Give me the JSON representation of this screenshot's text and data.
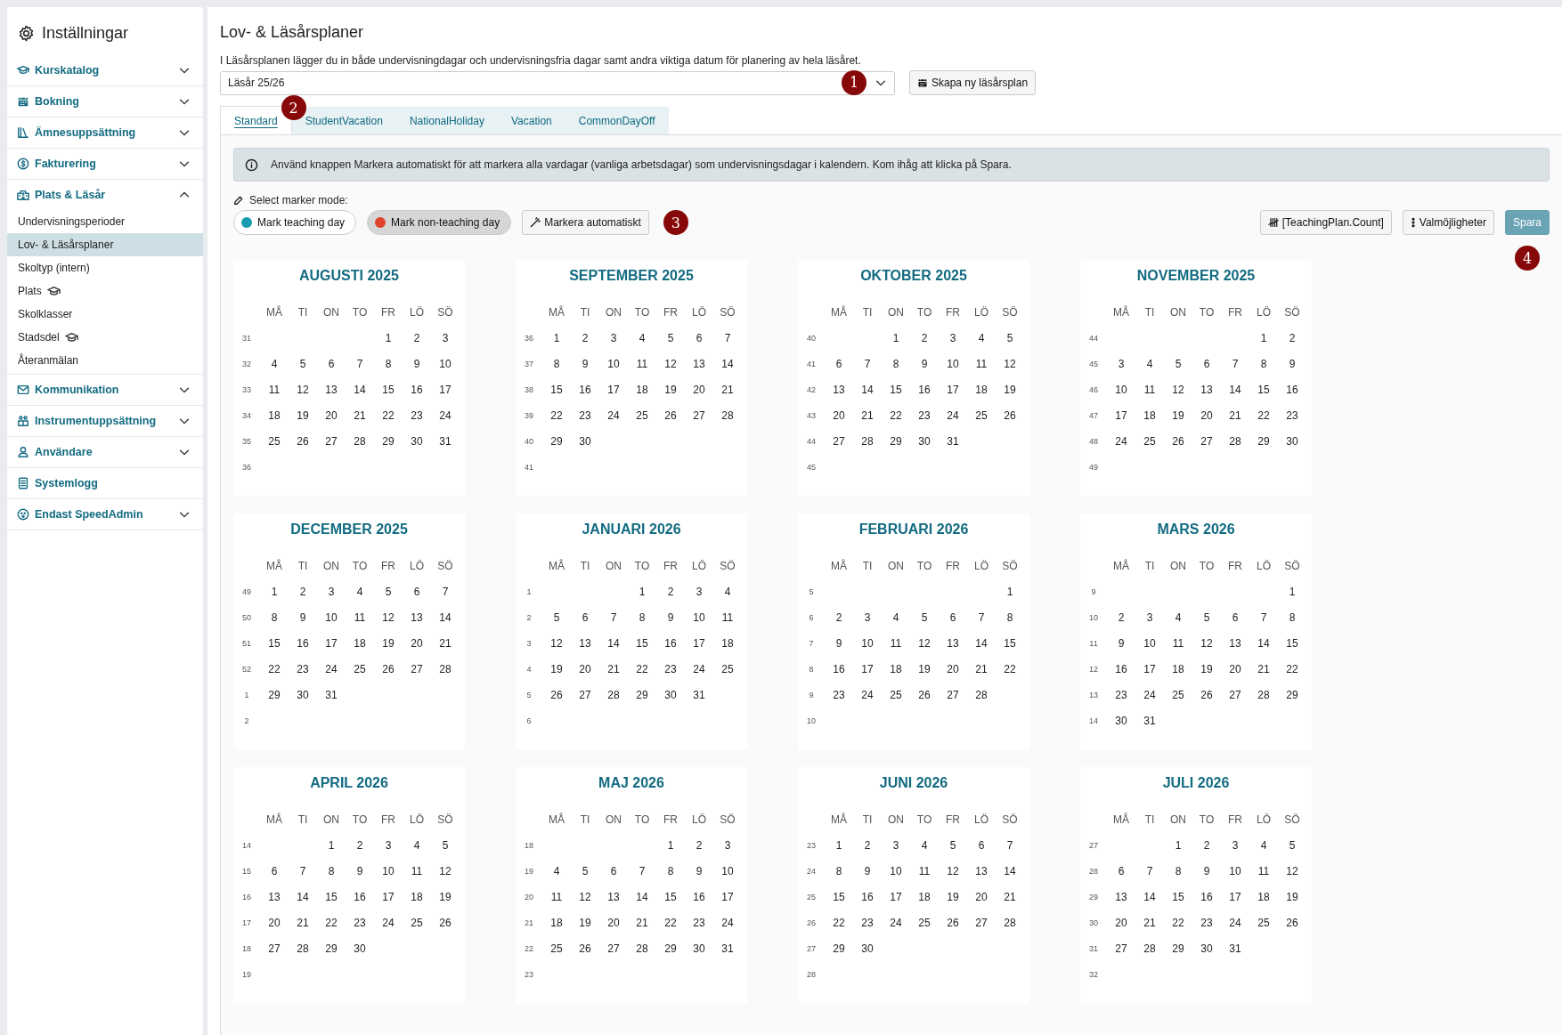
{
  "sidebar": {
    "title": "Inställningar",
    "sections": [
      {
        "label": "Kurskatalog",
        "expanded": false
      },
      {
        "label": "Bokning",
        "expanded": false
      },
      {
        "label": "Ämnesuppsättning",
        "expanded": false
      },
      {
        "label": "Fakturering",
        "expanded": false
      },
      {
        "label": "Plats & Läsår",
        "expanded": true,
        "items": [
          {
            "label": "Undervisningsperioder",
            "selected": false,
            "with_icon": false
          },
          {
            "label": "Lov- & Läsårsplaner",
            "selected": true,
            "with_icon": false
          },
          {
            "label": "Skoltyp (intern)",
            "selected": false,
            "with_icon": false
          },
          {
            "label": "Plats",
            "selected": false,
            "with_icon": true
          },
          {
            "label": "Skolklasser",
            "selected": false,
            "with_icon": false
          },
          {
            "label": "Stadsdel",
            "selected": false,
            "with_icon": true
          },
          {
            "label": "Återanmälan",
            "selected": false,
            "with_icon": false
          }
        ]
      },
      {
        "label": "Kommunikation",
        "expanded": false
      },
      {
        "label": "Instrumentuppsättning",
        "expanded": false
      },
      {
        "label": "Användare",
        "expanded": false
      },
      {
        "label": "Systemlogg"
      },
      {
        "label": "Endast SpeedAdmin",
        "expanded": false
      }
    ]
  },
  "page": {
    "title": "Lov- & Läsårsplaner",
    "description": "I Läsårsplanen lägger du in både undervisningdagar och undervisningsfria dagar samt andra viktiga datum för planering av hela läsåret.",
    "plan_select": {
      "value": "Läsår 25/26",
      "callout": "1"
    },
    "create_button": "Skapa ny läsårsplan",
    "tabs": [
      {
        "label": "Standard",
        "selected": true,
        "callout": "2"
      },
      {
        "label": "StudentVacation",
        "selected": false
      },
      {
        "label": "NationalHoliday",
        "selected": false
      },
      {
        "label": "Vacation",
        "selected": false
      },
      {
        "label": "CommonDayOff",
        "selected": false
      }
    ],
    "info": "Använd knappen Markera automatiskt för att markera alla vardagar (vanliga arbetsdagar) som undervisningsdagar i kalendern. Kom ihåg att klicka på Spara.",
    "marker_label": "Select marker mode:",
    "marker_modes": [
      {
        "label": "Mark teaching day",
        "selected": false,
        "color": "#1a9bb0"
      },
      {
        "label": "Mark non-teaching day",
        "selected": true,
        "color": "#e0442b"
      }
    ],
    "auto_button": {
      "label": "Markera automatiskt",
      "callout": "3"
    },
    "count_button": "[TeachingPlan.Count]",
    "options_button": "Valmöjligheter",
    "save_button": {
      "label": "Spara",
      "callout": "4"
    },
    "months": [
      {
        "title": "AUGUSTI 2025",
        "weekdays": [
          "MÅ",
          "TI",
          "ON",
          "TO",
          "FR",
          "LÖ",
          "SÖ"
        ],
        "weeks": [
          {
            "week": "31",
            "leading_blanks": true,
            "days": [
              "1",
              "2",
              "3"
            ]
          },
          {
            "week": "32",
            "days": [
              "4",
              "5",
              "6",
              "7",
              "8",
              "9",
              "10"
            ]
          },
          {
            "week": "33",
            "days": [
              "11",
              "12",
              "13",
              "14",
              "15",
              "16",
              "17"
            ]
          },
          {
            "week": "34",
            "days": [
              "18",
              "19",
              "20",
              "21",
              "22",
              "23",
              "24"
            ]
          },
          {
            "week": "35",
            "days": [
              "25",
              "26",
              "27",
              "28",
              "29",
              "30",
              "31"
            ]
          },
          {
            "week": "36"
          }
        ]
      },
      {
        "title": "SEPTEMBER 2025",
        "weekdays": [
          "MÅ",
          "TI",
          "ON",
          "TO",
          "FR",
          "LÖ",
          "SÖ"
        ],
        "weeks": [
          {
            "week": "36",
            "days": [
              "1",
              "2",
              "3",
              "4",
              "5",
              "6",
              "7"
            ]
          },
          {
            "week": "37",
            "days": [
              "8",
              "9",
              "10",
              "11",
              "12",
              "13",
              "14"
            ]
          },
          {
            "week": "38",
            "days": [
              "15",
              "16",
              "17",
              "18",
              "19",
              "20",
              "21"
            ]
          },
          {
            "week": "39",
            "days": [
              "22",
              "23",
              "24",
              "25",
              "26",
              "27",
              "28"
            ]
          },
          {
            "week": "40",
            "days": [
              "29",
              "30"
            ]
          },
          {
            "week": "41"
          }
        ]
      },
      {
        "title": "OKTOBER 2025",
        "weekdays": [
          "MÅ",
          "TI",
          "ON",
          "TO",
          "FR",
          "LÖ",
          "SÖ"
        ],
        "weeks": [
          {
            "week": "40",
            "leading_blanks": true,
            "days": [
              "1",
              "2",
              "3",
              "4",
              "5"
            ]
          },
          {
            "week": "41",
            "days": [
              "6",
              "7",
              "8",
              "9",
              "10",
              "11",
              "12"
            ]
          },
          {
            "week": "42",
            "days": [
              "13",
              "14",
              "15",
              "16",
              "17",
              "18",
              "19"
            ]
          },
          {
            "week": "43",
            "days": [
              "20",
              "21",
              "22",
              "23",
              "24",
              "25",
              "26"
            ]
          },
          {
            "week": "44",
            "days": [
              "27",
              "28",
              "29",
              "30",
              "31"
            ]
          },
          {
            "week": "45"
          }
        ]
      },
      {
        "title": "NOVEMBER 2025",
        "weekdays": [
          "MÅ",
          "TI",
          "ON",
          "TO",
          "FR",
          "LÖ",
          "SÖ"
        ],
        "weeks": [
          {
            "week": "44",
            "leading_blanks": true,
            "days": [
              "1",
              "2"
            ]
          },
          {
            "week": "45",
            "days": [
              "3",
              "4",
              "5",
              "6",
              "7",
              "8",
              "9"
            ]
          },
          {
            "week": "46",
            "days": [
              "10",
              "11",
              "12",
              "13",
              "14",
              "15",
              "16"
            ]
          },
          {
            "week": "47",
            "days": [
              "17",
              "18",
              "19",
              "20",
              "21",
              "22",
              "23"
            ]
          },
          {
            "week": "48",
            "days": [
              "24",
              "25",
              "26",
              "27",
              "28",
              "29",
              "30"
            ]
          },
          {
            "week": "49"
          }
        ]
      },
      {
        "title": "DECEMBER 2025",
        "weekdays": [
          "MÅ",
          "TI",
          "ON",
          "TO",
          "FR",
          "LÖ",
          "SÖ"
        ],
        "weeks": [
          {
            "week": "49",
            "days": [
              "1",
              "2",
              "3",
              "4",
              "5",
              "6",
              "7"
            ]
          },
          {
            "week": "50",
            "days": [
              "8",
              "9",
              "10",
              "11",
              "12",
              "13",
              "14"
            ]
          },
          {
            "week": "51",
            "days": [
              "15",
              "16",
              "17",
              "18",
              "19",
              "20",
              "21"
            ]
          },
          {
            "week": "52",
            "days": [
              "22",
              "23",
              "24",
              "25",
              "26",
              "27",
              "28"
            ]
          },
          {
            "week": "1",
            "days": [
              "29",
              "30",
              "31"
            ]
          },
          {
            "week": "2"
          }
        ]
      },
      {
        "title": "JANUARI 2026",
        "weekdays": [
          "MÅ",
          "TI",
          "ON",
          "TO",
          "FR",
          "LÖ",
          "SÖ"
        ],
        "weeks": [
          {
            "week": "1",
            "leading_blanks": true,
            "days": [
              "1",
              "2",
              "3",
              "4"
            ]
          },
          {
            "week": "2",
            "days": [
              "5",
              "6",
              "7",
              "8",
              "9",
              "10",
              "11"
            ]
          },
          {
            "week": "3",
            "days": [
              "12",
              "13",
              "14",
              "15",
              "16",
              "17",
              "18"
            ]
          },
          {
            "week": "4",
            "days": [
              "19",
              "20",
              "21",
              "22",
              "23",
              "24",
              "25"
            ]
          },
          {
            "week": "5",
            "days": [
              "26",
              "27",
              "28",
              "29",
              "30",
              "31"
            ]
          },
          {
            "week": "6"
          }
        ]
      },
      {
        "title": "FEBRUARI 2026",
        "weekdays": [
          "MÅ",
          "TI",
          "ON",
          "TO",
          "FR",
          "LÖ",
          "SÖ"
        ],
        "weeks": [
          {
            "week": "5",
            "leading_blanks": true,
            "days": [
              "1"
            ]
          },
          {
            "week": "6",
            "days": [
              "2",
              "3",
              "4",
              "5",
              "6",
              "7",
              "8"
            ]
          },
          {
            "week": "7",
            "days": [
              "9",
              "10",
              "11",
              "12",
              "13",
              "14",
              "15"
            ]
          },
          {
            "week": "8",
            "days": [
              "16",
              "17",
              "18",
              "19",
              "20",
              "21",
              "22"
            ]
          },
          {
            "week": "9",
            "days": [
              "23",
              "24",
              "25",
              "26",
              "27",
              "28"
            ]
          },
          {
            "week": "10"
          }
        ]
      },
      {
        "title": "MARS 2026",
        "weekdays": [
          "MÅ",
          "TI",
          "ON",
          "TO",
          "FR",
          "LÖ",
          "SÖ"
        ],
        "weeks": [
          {
            "week": "9",
            "leading_blanks": true,
            "days": [
              "1"
            ]
          },
          {
            "week": "10",
            "days": [
              "2",
              "3",
              "4",
              "5",
              "6",
              "7",
              "8"
            ]
          },
          {
            "week": "11",
            "days": [
              "9",
              "10",
              "11",
              "12",
              "13",
              "14",
              "15"
            ]
          },
          {
            "week": "12",
            "days": [
              "16",
              "17",
              "18",
              "19",
              "20",
              "21",
              "22"
            ]
          },
          {
            "week": "13",
            "days": [
              "23",
              "24",
              "25",
              "26",
              "27",
              "28",
              "29"
            ]
          },
          {
            "week": "14",
            "days": [
              "30",
              "31"
            ]
          }
        ]
      },
      {
        "title": "APRIL 2026",
        "weekdays": [
          "MÅ",
          "TI",
          "ON",
          "TO",
          "FR",
          "LÖ",
          "SÖ"
        ],
        "weeks": [
          {
            "week": "14",
            "leading_blanks": true,
            "days": [
              "1",
              "2",
              "3",
              "4",
              "5"
            ]
          },
          {
            "week": "15",
            "days": [
              "6",
              "7",
              "8",
              "9",
              "10",
              "11",
              "12"
            ]
          },
          {
            "week": "16",
            "days": [
              "13",
              "14",
              "15",
              "16",
              "17",
              "18",
              "19"
            ]
          },
          {
            "week": "17",
            "days": [
              "20",
              "21",
              "22",
              "23",
              "24",
              "25",
              "26"
            ]
          },
          {
            "week": "18",
            "days": [
              "27",
              "28",
              "29",
              "30"
            ]
          },
          {
            "week": "19"
          }
        ]
      },
      {
        "title": "MAJ 2026",
        "weekdays": [
          "MÅ",
          "TI",
          "ON",
          "TO",
          "FR",
          "LÖ",
          "SÖ"
        ],
        "weeks": [
          {
            "week": "18",
            "leading_blanks": true,
            "days": [
              "1",
              "2",
              "3"
            ]
          },
          {
            "week": "19",
            "days": [
              "4",
              "5",
              "6",
              "7",
              "8",
              "9",
              "10"
            ]
          },
          {
            "week": "20",
            "days": [
              "11",
              "12",
              "13",
              "14",
              "15",
              "16",
              "17"
            ]
          },
          {
            "week": "21",
            "days": [
              "18",
              "19",
              "20",
              "21",
              "22",
              "23",
              "24"
            ]
          },
          {
            "week": "22",
            "days": [
              "25",
              "26",
              "27",
              "28",
              "29",
              "30",
              "31"
            ]
          },
          {
            "week": "23"
          }
        ]
      },
      {
        "title": "JUNI 2026",
        "weekdays": [
          "MÅ",
          "TI",
          "ON",
          "TO",
          "FR",
          "LÖ",
          "SÖ"
        ],
        "weeks": [
          {
            "week": "23",
            "days": [
              "1",
              "2",
              "3",
              "4",
              "5",
              "6",
              "7"
            ]
          },
          {
            "week": "24",
            "days": [
              "8",
              "9",
              "10",
              "11",
              "12",
              "13",
              "14"
            ]
          },
          {
            "week": "25",
            "days": [
              "15",
              "16",
              "17",
              "18",
              "19",
              "20",
              "21"
            ]
          },
          {
            "week": "26",
            "days": [
              "22",
              "23",
              "24",
              "25",
              "26",
              "27",
              "28"
            ]
          },
          {
            "week": "27",
            "days": [
              "29",
              "30"
            ]
          },
          {
            "week": "28"
          }
        ]
      },
      {
        "title": "JULI 2026",
        "weekdays": [
          "MÅ",
          "TI",
          "ON",
          "TO",
          "FR",
          "LÖ",
          "SÖ"
        ],
        "weeks": [
          {
            "week": "27",
            "leading_blanks": true,
            "days": [
              "1",
              "2",
              "3",
              "4",
              "5"
            ]
          },
          {
            "week": "28",
            "days": [
              "6",
              "7",
              "8",
              "9",
              "10",
              "11",
              "12"
            ]
          },
          {
            "week": "29",
            "days": [
              "13",
              "14",
              "15",
              "16",
              "17",
              "18",
              "19"
            ]
          },
          {
            "week": "30",
            "days": [
              "20",
              "21",
              "22",
              "23",
              "24",
              "25",
              "26"
            ]
          },
          {
            "week": "31",
            "days": [
              "27",
              "28",
              "29",
              "30",
              "31"
            ]
          },
          {
            "week": "32"
          }
        ]
      }
    ]
  }
}
